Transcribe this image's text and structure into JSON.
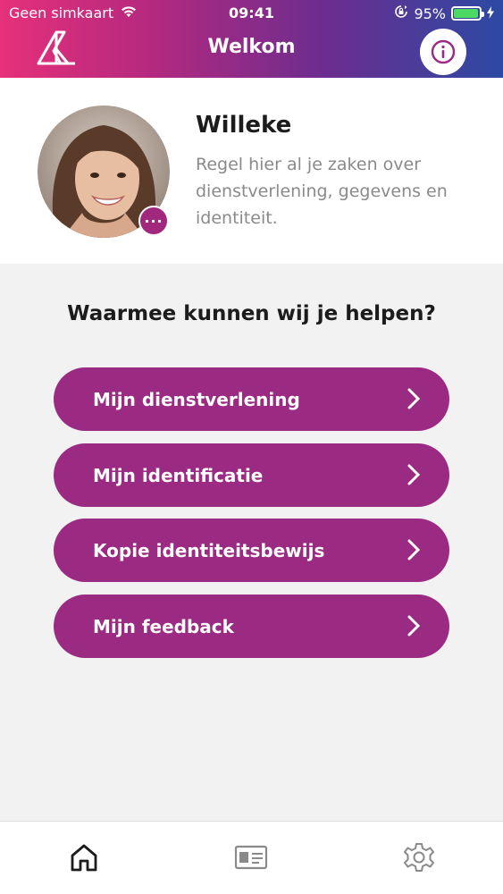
{
  "status_bar": {
    "carrier": "Geen simkaart",
    "time": "09:41",
    "battery_percent": "95%",
    "battery_level": 0.95,
    "icons": [
      "wifi-icon",
      "orientation-lock-icon",
      "battery-icon",
      "charging-icon"
    ]
  },
  "header": {
    "title": "Welkom",
    "logo_icon": "app-logo",
    "info_icon": "info-icon"
  },
  "profile": {
    "name": "Willeke",
    "description": "Regel hier al je zaken over dienstverlening, gegevens en identiteit.",
    "more_label": "···"
  },
  "main": {
    "question": "Waarmee kunnen wij je helpen?",
    "buttons": [
      {
        "label": "Mijn dienstverlening"
      },
      {
        "label": "Mijn identificatie"
      },
      {
        "label": "Kopie identiteitsbewijs"
      },
      {
        "label": "Mijn feedback"
      }
    ]
  },
  "tabbar": {
    "items": [
      "home-icon",
      "id-card-icon",
      "settings-icon"
    ],
    "active": "home-icon"
  },
  "colors": {
    "accent": "#9b2a82",
    "header_gradient_start": "#e6307a",
    "header_gradient_end": "#2c4aa3",
    "battery": "#4cd964"
  }
}
